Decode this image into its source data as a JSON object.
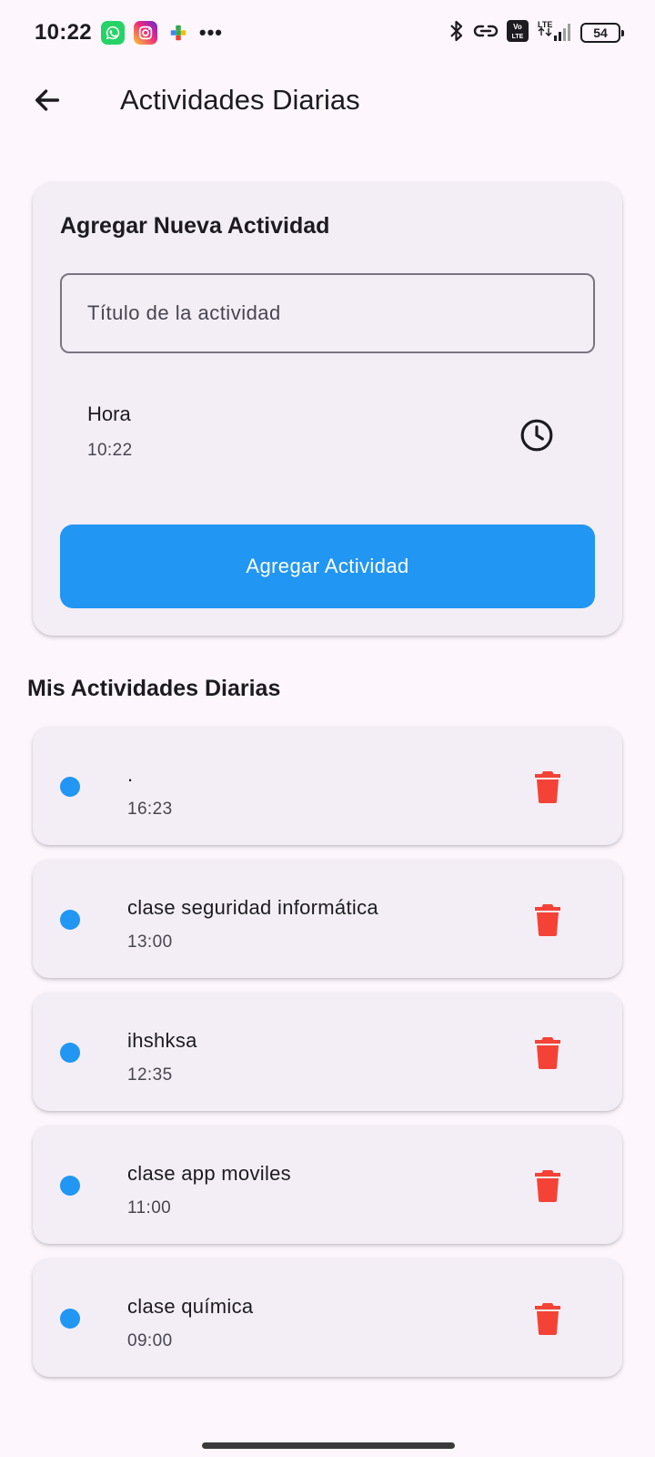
{
  "status_bar": {
    "time": "10:22",
    "battery": "54",
    "network": "LTE",
    "volte": "Vo LTE",
    "icons": [
      "whatsapp-icon",
      "instagram-icon",
      "puzzle-app-icon",
      "more-icon",
      "bluetooth-icon",
      "link-icon",
      "volte-icon",
      "lte-signal-icon",
      "battery-icon"
    ]
  },
  "app_bar": {
    "title": "Actividades Diarias",
    "back_icon": "arrow-back-icon"
  },
  "form": {
    "heading": "Agregar Nueva Actividad",
    "title_placeholder": "Título de la actividad",
    "title_value": "",
    "time_label": "Hora",
    "time_value": "10:22",
    "time_icon": "clock-icon",
    "submit_label": "Agregar Actividad"
  },
  "list": {
    "heading": "Mis Actividades Diarias",
    "items": [
      {
        "title": ".",
        "time": "16:23"
      },
      {
        "title": "clase seguridad informática",
        "time": "13:00"
      },
      {
        "title": "ihshksa",
        "time": "12:35"
      },
      {
        "title": "clase app moviles",
        "time": "11:00"
      },
      {
        "title": "clase química",
        "time": "09:00"
      }
    ]
  },
  "colors": {
    "accent": "#2196F3",
    "delete": "#F44336",
    "card_bg": "#F3EEF6",
    "page_bg": "#FDF7FD"
  }
}
